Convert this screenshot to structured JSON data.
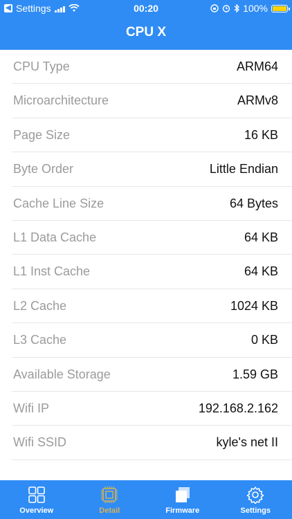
{
  "status_bar": {
    "carrier": "Settings",
    "time": "00:20",
    "battery_percent": "100%"
  },
  "header": {
    "title": "CPU X"
  },
  "rows": [
    {
      "label": "CPU Type",
      "value": "ARM64"
    },
    {
      "label": "Microarchitecture",
      "value": "ARMv8"
    },
    {
      "label": "Page Size",
      "value": "16 KB"
    },
    {
      "label": "Byte Order",
      "value": "Little Endian"
    },
    {
      "label": "Cache Line Size",
      "value": "64 Bytes"
    },
    {
      "label": "L1 Data Cache",
      "value": "64 KB"
    },
    {
      "label": "L1 Inst Cache",
      "value": "64 KB"
    },
    {
      "label": "L2 Cache",
      "value": "1024 KB"
    },
    {
      "label": "L3 Cache",
      "value": "0 KB"
    },
    {
      "label": "Available Storage",
      "value": "1.59 GB"
    },
    {
      "label": "Wifi IP",
      "value": "192.168.2.162"
    },
    {
      "label": "Wifi SSID",
      "value": "kyle's net II"
    }
  ],
  "tabs": [
    {
      "label": "Overview",
      "icon": "grid-icon",
      "active": false
    },
    {
      "label": "Detail",
      "icon": "chip-icon",
      "active": true
    },
    {
      "label": "Firmware",
      "icon": "stack-icon",
      "active": false
    },
    {
      "label": "Settings",
      "icon": "gear-icon",
      "active": false
    }
  ],
  "colors": {
    "accent": "#2f8cf5",
    "active_tab": "#d4b15a"
  }
}
